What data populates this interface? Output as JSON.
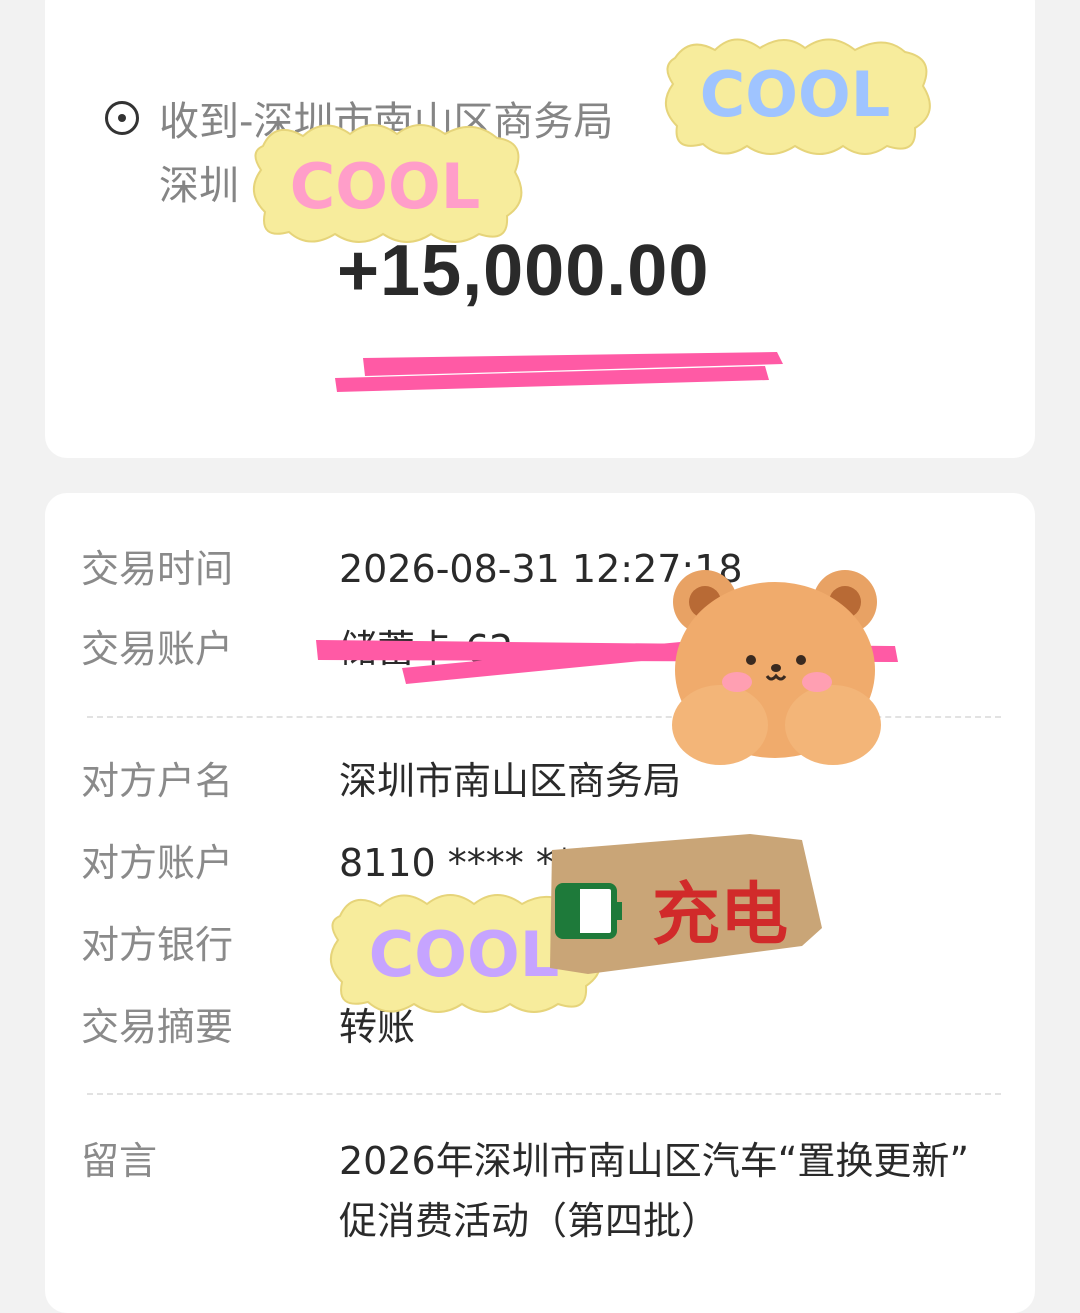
{
  "transaction": {
    "destination_line1": "收到-深圳市南山区商务局",
    "destination_line2": "深圳",
    "amount": "+15,000.00"
  },
  "details": {
    "time_label": "交易时间",
    "time_value": "2026-08-31 12:27:18",
    "account_label": "交易账户",
    "account_value": "储蓄卡 62",
    "payee_name_label": "对方户名",
    "payee_name_value": "深圳市南山区商务局",
    "payee_account_label": "对方账户",
    "payee_account_value": "8110 **** ****",
    "payee_bank_label": "对方银行",
    "payee_bank_value": "",
    "summary_label": "交易摘要",
    "summary_value": "转账",
    "message_label": "留言",
    "message_line1": "2026年深圳市南山区汽车“置换更新”",
    "message_line2": "促消费活动（第四批）"
  },
  "stickers": {
    "cool_text": "COOL",
    "charge_text": "充电",
    "highlight_color": "#ff5aa5",
    "sticker_yellow": "#f7ec9c"
  }
}
